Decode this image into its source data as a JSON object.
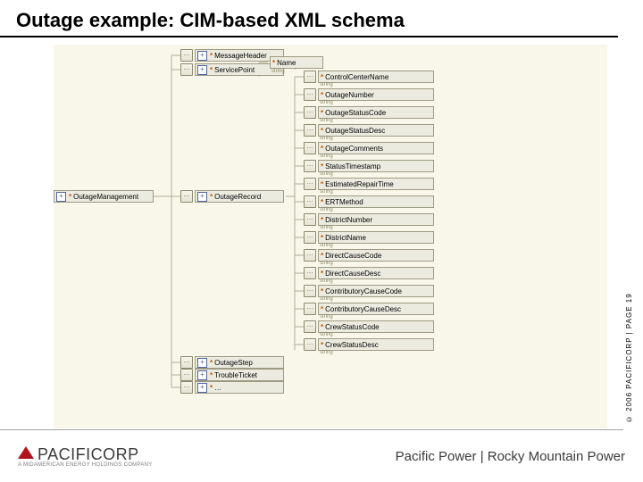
{
  "title": "Outage example: CIM-based XML schema",
  "copyright": "© 2006 PACIFICORP | PAGE 19",
  "footer": {
    "logo": "PACIFICORP",
    "logo_sub": "A MIDAMERICAN ENERGY HOLDINGS COMPANY",
    "brands": "Pacific Power | Rocky Mountain Power"
  },
  "nodes": {
    "root": "OutageManagement",
    "l1": [
      "MessageHeader",
      "ServicePoint",
      "OutageRecord",
      "OutageStep",
      "TroubleTicket"
    ],
    "service_children": [
      "Name"
    ],
    "record_children": [
      "ControlCenterName",
      "OutageNumber",
      "OutageStatusCode",
      "OutageStatusDesc",
      "OutageComments",
      "StatusTimestamp",
      "EstimatedRepairTime",
      "ERTMethod",
      "DistrictNumber",
      "DistrictName",
      "DirectCauseCode",
      "DirectCauseDesc",
      "ContributoryCauseCode",
      "ContributoryCauseDesc",
      "CrewStatusCode",
      "CrewStatusDesc"
    ],
    "type_label": "string"
  }
}
